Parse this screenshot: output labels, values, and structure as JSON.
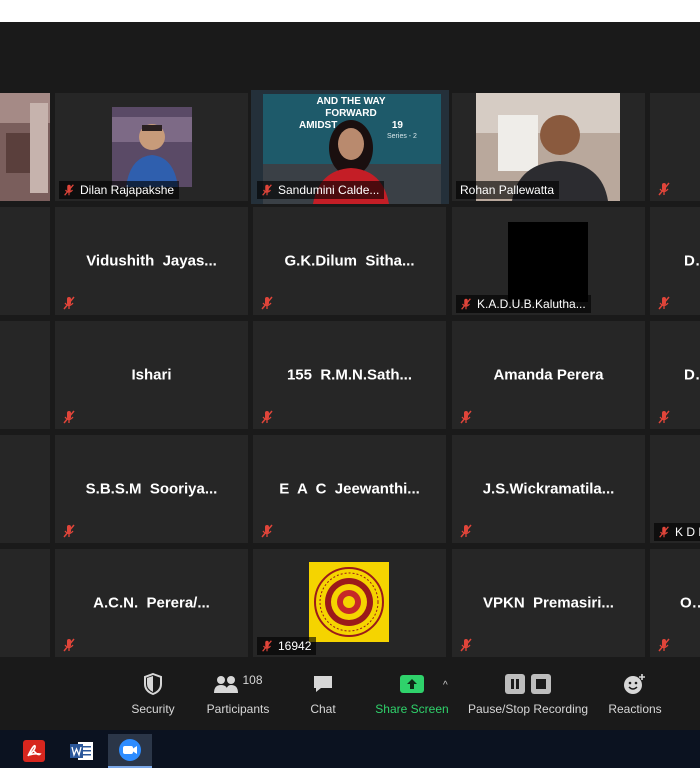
{
  "meeting": {
    "participants": [
      {
        "name": "Dilan Rajapakshe"
      },
      {
        "name": "Sandumini Calde..."
      },
      {
        "name": "Rohan Pallewatta"
      },
      {
        "name": "Vidushith  Jayas..."
      },
      {
        "name": "G.K.Dilum  Sitha..."
      },
      {
        "name": "K.A.D.U.B.Kalutha..."
      },
      {
        "name": "Di"
      },
      {
        "name": "Ishari"
      },
      {
        "name": "155  R.M.N.Sath..."
      },
      {
        "name": "Amanda Perera"
      },
      {
        "name": "Du"
      },
      {
        "name": "S.B.S.M  Sooriya..."
      },
      {
        "name": "E  A  C  Jeewanthi..."
      },
      {
        "name": "J.S.Wickramatila..."
      },
      {
        "name": "K D H"
      },
      {
        "name": "A.C.N.  Perera/..."
      },
      {
        "name": "16942"
      },
      {
        "name": "VPKN  Premasiri..."
      },
      {
        "name": "O.A"
      }
    ],
    "slide_text": {
      "line1": "AND THE WAY FORWARD",
      "line2": "AMIDST",
      "line2_suffix": "19",
      "series": "Series - 2"
    }
  },
  "toolbar": {
    "security": {
      "label": "Security",
      "icon": "shield-icon"
    },
    "participants": {
      "label": "Participants",
      "count": "108",
      "icon": "people-icon"
    },
    "chat": {
      "label": "Chat",
      "icon": "chat-bubble-icon"
    },
    "share": {
      "label": "Share Screen",
      "icon": "share-arrow-icon",
      "caret": "^"
    },
    "recording": {
      "label": "Pause/Stop Recording",
      "icon": "pause-stop-icon"
    },
    "reactions": {
      "label": "Reactions",
      "icon": "emoji-plus-icon"
    }
  },
  "taskbar": {
    "apps": [
      {
        "name": "pdf-reader",
        "icon": "acrobat-icon"
      },
      {
        "name": "word",
        "icon": "word-icon"
      },
      {
        "name": "zoom",
        "icon": "zoom-icon",
        "active": true
      }
    ]
  },
  "colors": {
    "tile_bg": "#262626",
    "active_speaker_border": "#c9e26a",
    "share_green": "#2fd26b",
    "muted_red": "#e0453a"
  }
}
